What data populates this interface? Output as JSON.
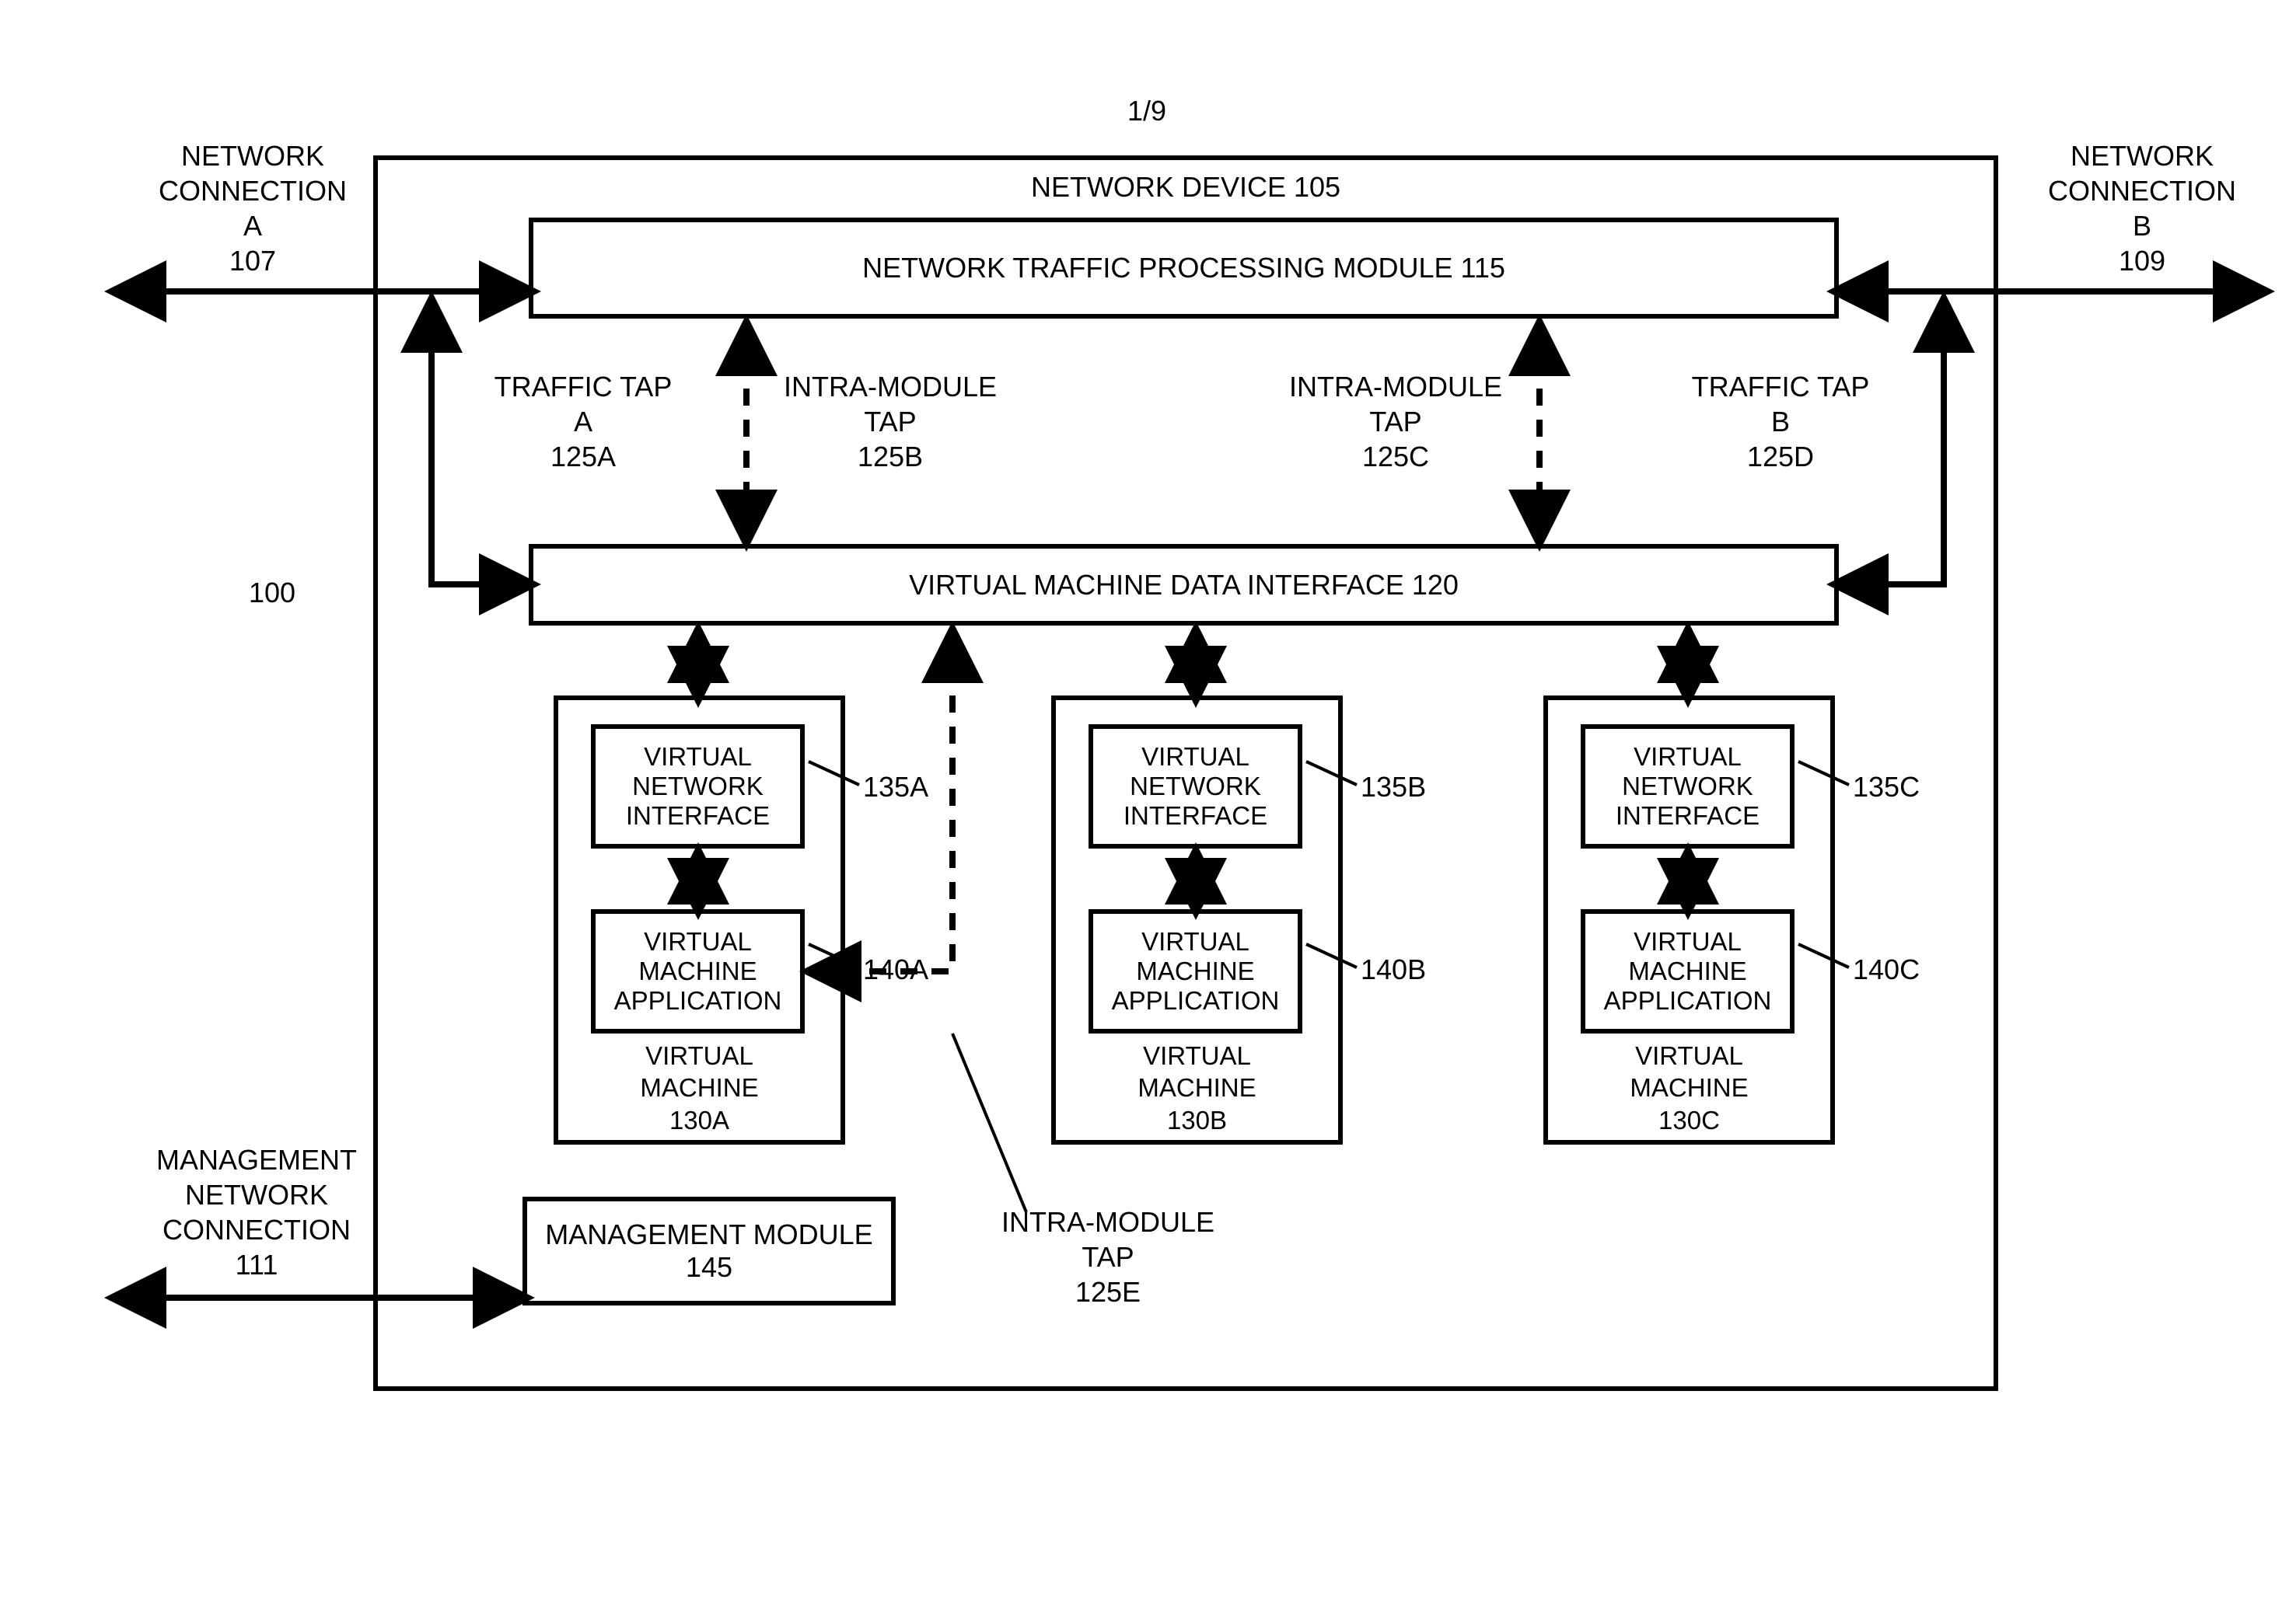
{
  "pageNumber": "1/9",
  "overallRef": "100",
  "networkConnectionA": {
    "line1": "NETWORK",
    "line2": "CONNECTION",
    "line3": "A",
    "ref": "107"
  },
  "networkConnectionB": {
    "line1": "NETWORK",
    "line2": "CONNECTION",
    "line3": "B",
    "ref": "109"
  },
  "managementNetwork": {
    "line1": "MANAGEMENT",
    "line2": "NETWORK",
    "line3": "CONNECTION",
    "ref": "111"
  },
  "deviceTitle": "NETWORK DEVICE 105",
  "ntpModule": "NETWORK TRAFFIC PROCESSING MODULE 115",
  "vmdi": "VIRTUAL MACHINE DATA INTERFACE 120",
  "trafficTapA": {
    "line1": "TRAFFIC TAP",
    "line2": "A",
    "ref": "125A"
  },
  "intraTapB": {
    "line1": "INTRA-MODULE",
    "line2": "TAP",
    "ref": "125B"
  },
  "intraTapC": {
    "line1": "INTRA-MODULE",
    "line2": "TAP",
    "ref": "125C"
  },
  "trafficTapD": {
    "line1": "TRAFFIC TAP",
    "line2": "B",
    "ref": "125D"
  },
  "intraTapE": {
    "line1": "INTRA-MODULE",
    "line2": "TAP",
    "ref": "125E"
  },
  "vni": {
    "line1": "VIRTUAL",
    "line2": "NETWORK",
    "line3": "INTERFACE"
  },
  "vma": {
    "line1": "VIRTUAL",
    "line2": "MACHINE",
    "line3": "APPLICATION"
  },
  "vmTitle": {
    "line1": "VIRTUAL",
    "line2": "MACHINE"
  },
  "vmRefs": {
    "a": "130A",
    "b": "130B",
    "c": "130C"
  },
  "vniRefs": {
    "a": "135A",
    "b": "135B",
    "c": "135C"
  },
  "vmaRefs": {
    "a": "140A",
    "b": "140B",
    "c": "140C"
  },
  "managementModule": {
    "line1": "MANAGEMENT MODULE",
    "ref": "145"
  }
}
